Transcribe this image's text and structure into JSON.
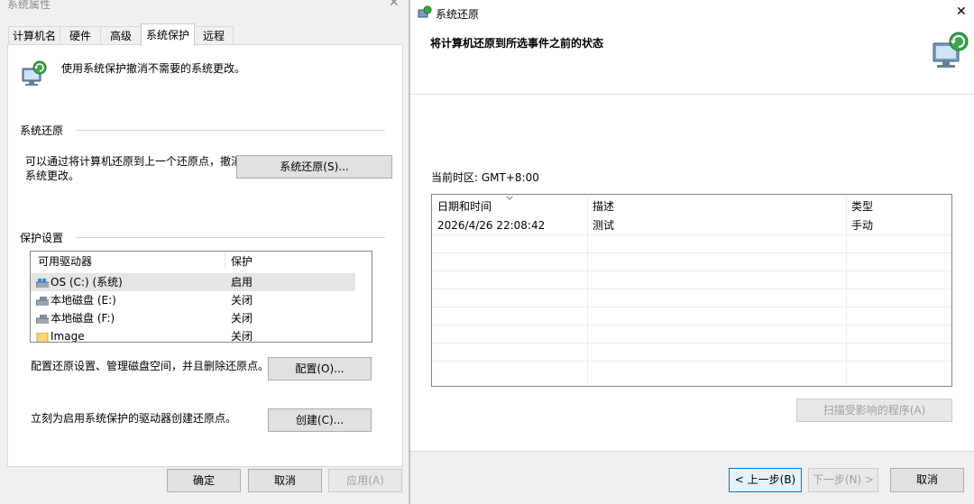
{
  "system_properties": {
    "title": "系统属性",
    "close_glyph": "✕",
    "tabs": [
      {
        "label": "计算机名"
      },
      {
        "label": "硬件"
      },
      {
        "label": "高级"
      },
      {
        "label": "系统保护",
        "active": true
      },
      {
        "label": "远程"
      }
    ],
    "intro_text": "使用系统保护撤消不需要的系统更改。",
    "restore_group": {
      "title": "系统还原",
      "description_line1": "可以通过将计算机还原到上一个还原点，撤消",
      "description_line2": "系统更改。",
      "button_label": "系统还原(S)..."
    },
    "protection_group": {
      "title": "保护设置",
      "columns": [
        "可用驱动器",
        "保护"
      ],
      "drives": [
        {
          "name": "OS (C:) (系统)",
          "protection": "启用",
          "icon": "system-drive-icon",
          "selected": true
        },
        {
          "name": "本地磁盘 (E:)",
          "protection": "关闭",
          "icon": "drive-icon"
        },
        {
          "name": "本地磁盘 (F:)",
          "protection": "关闭",
          "icon": "drive-icon"
        },
        {
          "name": "Image",
          "protection": "关闭",
          "icon": "folder-icon"
        }
      ],
      "configure_text": "配置还原设置、管理磁盘空间，并且删除还原点。",
      "configure_button": "配置(O)...",
      "create_text": "立刻为启用系统保护的驱动器创建还原点。",
      "create_button": "创建(C)..."
    },
    "footer": {
      "ok": "确定",
      "cancel": "取消",
      "apply": "应用(A)"
    }
  },
  "system_restore": {
    "title": "系统还原",
    "close_glyph": "✕",
    "heading": "将计算机还原到所选事件之前的状态",
    "timezone": "当前时区: GMT+8:00",
    "columns": [
      "日期和时间",
      "描述",
      "类型"
    ],
    "restore_points": [
      {
        "datetime": "2026/4/26 22:08:42",
        "description": "测试",
        "type": "手动"
      }
    ],
    "scan_button": "扫描受影响的程序(A)",
    "back_button": "< 上一步(B)",
    "next_button": "下一步(N) >",
    "cancel_button": "取消"
  },
  "colors": {
    "window_bg": "#f0f0f0",
    "panel_bg": "#ffffff",
    "accent": "#0078d7",
    "disabled_text": "#a0a0a0"
  }
}
